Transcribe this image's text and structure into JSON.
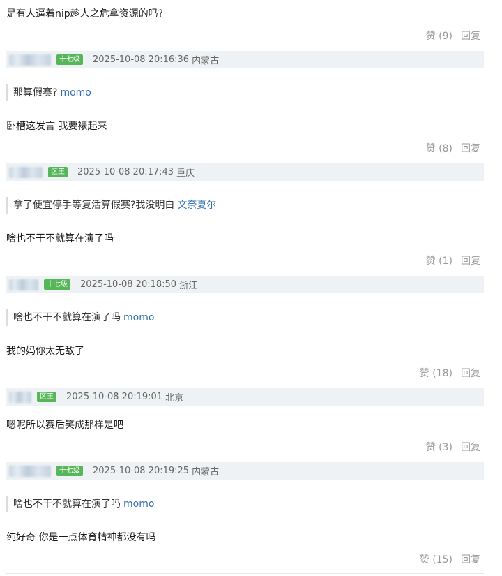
{
  "comments": [
    {
      "text": "是有人逼着nip趁人之危拿资源的吗?",
      "likes": "赞 (9)",
      "reply": "回复",
      "badge": "十七级",
      "time": "2025-10-08 20:16:36",
      "location": "内蒙古",
      "quote": "那算假赛?",
      "quote_user": "momo"
    },
    {
      "text": "卧槽这发言 我要裱起来",
      "likes": "赞 (8)",
      "reply": "回复",
      "badge": "区王",
      "time": "2025-10-08 20:17:43",
      "location": "重庆",
      "quote": "拿了便宜停手等复活算假赛?我没明白",
      "quote_user": "文奈夏尔"
    },
    {
      "text": "啥也不干不就算在演了吗",
      "likes": "赞 (1)",
      "reply": "回复",
      "badge": "十七级",
      "time": "2025-10-08 20:18:50",
      "location": "浙江",
      "quote": "啥也不干不就算在演了吗",
      "quote_user": "momo"
    },
    {
      "text": "我的妈你太无敌了",
      "likes": "赞 (18)",
      "reply": "回复",
      "badge": "区王",
      "time": "2025-10-08 20:19:01",
      "location": "北京"
    },
    {
      "text": "嗯呢所以赛后笑成那样是吧",
      "likes": "赞 (3)",
      "reply": "回复",
      "badge": "十七级",
      "time": "2025-10-08 20:19:25",
      "location": "内蒙古",
      "quote": "啥也不干不就算在演了吗",
      "quote_user": "momo"
    },
    {
      "text": "纯好奇 你是一点体育精神都没有吗",
      "likes": "赞 (15)",
      "reply": "回复"
    }
  ]
}
